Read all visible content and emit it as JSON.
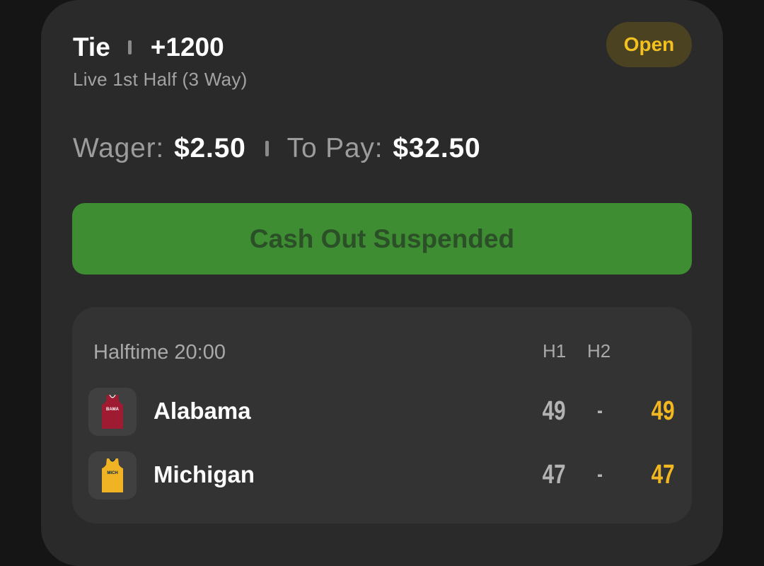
{
  "bet": {
    "selection": "Tie",
    "odds": "+1200",
    "market": "Live 1st Half (3 Way)",
    "status": "Open",
    "wager_label": "Wager:",
    "wager_value": "$2.50",
    "topay_label": "To Pay:",
    "topay_value": "$32.50",
    "cashout_label": "Cash Out Suspended"
  },
  "scoreboard": {
    "clock": "Halftime 20:00",
    "col_h1": "H1",
    "col_h2": "H2",
    "teams": [
      {
        "name": "Alabama",
        "jersey_text": "BAMA",
        "jersey_color": "#9e1b32",
        "h1": "49",
        "dash": "-",
        "total": "49"
      },
      {
        "name": "Michigan",
        "jersey_text": "MICH",
        "jersey_color": "#f0b323",
        "h1": "47",
        "dash": "-",
        "total": "47"
      }
    ]
  },
  "colors": {
    "accent_yellow": "#f2c021",
    "cashout_green": "#3e8d33",
    "card_bg": "#2a2a2a"
  }
}
